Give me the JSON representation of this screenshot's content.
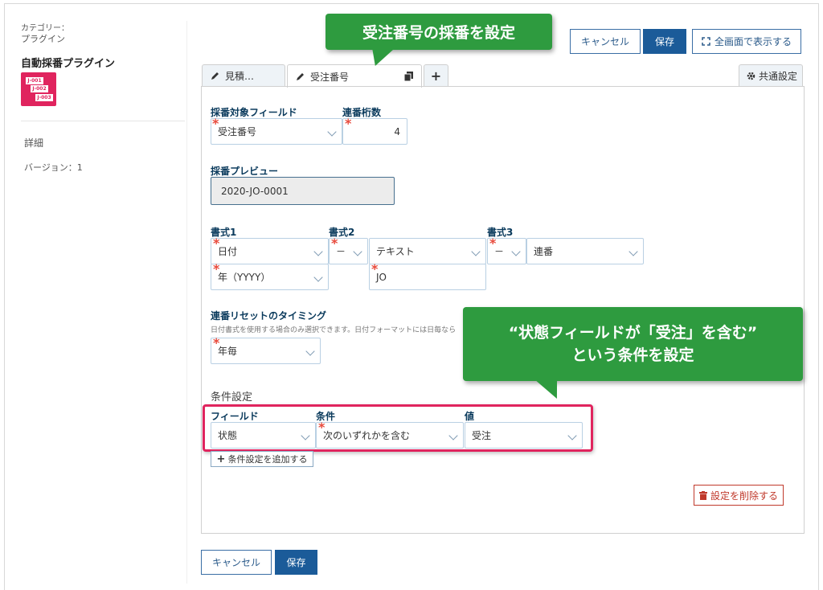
{
  "sidebar": {
    "category_label": "カテゴリー：",
    "category_value": "プラグイン",
    "plugin_name": "自動採番プラグイン",
    "icon_lines": [
      "J-001",
      "J-002",
      "J-003"
    ],
    "detail_label": "詳細",
    "version_text": "バージョン：1"
  },
  "header": {
    "cancel_label": "キャンセル",
    "save_label": "保存",
    "fullscreen_label": "全画面で表示する"
  },
  "callouts": {
    "top": "受注番号の採番を設定",
    "bottom_line1": "“状態フィールドが「受注」を含む”",
    "bottom_line2": "という条件を設定"
  },
  "tabs": [
    {
      "label": "見積…"
    },
    {
      "label": "受注番号"
    }
  ],
  "common_settings_label": "共通設定",
  "form": {
    "target_field_label": "採番対象フィールド",
    "target_field_value": "受注番号",
    "digits_label": "連番桁数",
    "digits_value": "4",
    "preview_label": "採番プレビュー",
    "preview_value": "2020-JO-0001",
    "format1_label": "書式1",
    "format2_label": "書式2",
    "format3_label": "書式3",
    "format1_value": "日付",
    "format1_sub_value": "年（YYYY）",
    "format2_sep": "－",
    "format2_value": "テキスト",
    "format2_text": "JO",
    "format3_sep": "－",
    "format3_value": "連番",
    "reset_label": "連番リセットのタイミング",
    "reset_help": "日付書式を使用する場合のみ選択できます。日付フォーマットには日毎なら",
    "reset_value": "年毎",
    "condition_section_label": "条件設定",
    "cond_field_label": "フィールド",
    "cond_cond_label": "条件",
    "cond_value_label": "値",
    "cond_field_value": "状態",
    "cond_cond_value": "次のいずれかを含む",
    "cond_value_value": "受注",
    "add_condition_label": "条件設定を追加する",
    "delete_settings_label": "設定を削除する"
  },
  "footer": {
    "cancel_label": "キャンセル",
    "save_label": "保存"
  },
  "colors": {
    "primary": "#1b5b99",
    "callout_green": "#2e9b3f",
    "highlight_red": "#e0245e",
    "required_red": "#e84a3c"
  }
}
